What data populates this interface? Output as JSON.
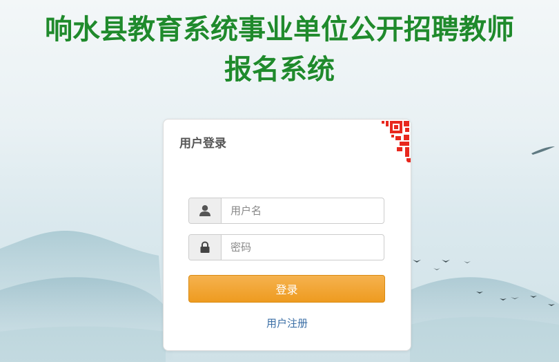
{
  "page": {
    "title_line1": "响水县教育系统事业单位公开招聘教师",
    "title_line2": "报名系统",
    "title_color": "#1f8a2c",
    "accent_color": "#ee9b20",
    "link_color": "#3a6ea5"
  },
  "login": {
    "header": "用户登录",
    "username_placeholder": "用户名",
    "username_icon": "user-icon",
    "password_placeholder": "密码",
    "password_icon": "lock-icon",
    "login_label": "登录",
    "register_label": "用户注册",
    "corner_icon": "qr-code-icon"
  }
}
